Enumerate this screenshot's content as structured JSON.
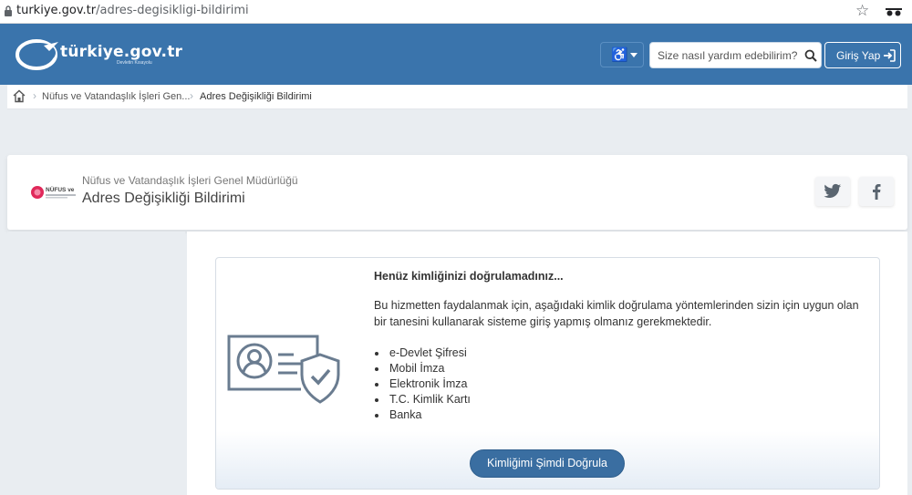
{
  "browser": {
    "url_host": "turkiye.gov.tr",
    "url_path": "/adres-degisikligi-bildirimi"
  },
  "header": {
    "logo_text": "türkiye.gov.tr",
    "logo_sub": "Devletin Kısayolu",
    "search_placeholder": "Size nasıl yardım edebilirim?",
    "login_label": "Giriş Yap",
    "accent_color": "#3a74ac"
  },
  "breadcrumb": {
    "items": [
      "Nüfus ve Vatandaşlık İşleri Gen...",
      "Adres Değişikliği Bildirimi"
    ]
  },
  "service": {
    "institution_logo_text": "NÜFUS ve",
    "institution": "Nüfus ve Vatandaşlık İşleri Genel Müdürlüğü",
    "title": "Adres Değişikliği Bildirimi"
  },
  "auth": {
    "title": "Henüz kimliğinizi doğrulamadınız...",
    "description": "Bu hizmetten faydalanmak için, aşağıdaki kimlik doğrulama yöntemlerinden sizin için uygun olan bir tanesini kullanarak sisteme giriş yapmış olmanız gerekmektedir.",
    "methods": [
      "e-Devlet Şifresi",
      "Mobil İmza",
      "Elektronik İmza",
      "T.C. Kimlik Kartı",
      "Banka"
    ],
    "verify_button": "Kimliğimi Şimdi Doğrula"
  }
}
